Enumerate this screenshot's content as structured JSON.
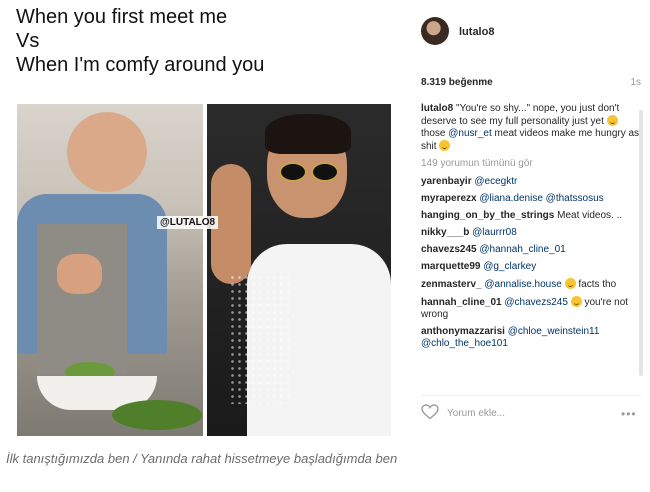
{
  "meme": {
    "line1": "When you first meet me",
    "line2": "Vs",
    "line3": "When I'm comfy around you",
    "watermark": "@LUTALO8"
  },
  "post": {
    "username": "lutalo8",
    "likes": "8.319 beğenme",
    "time": "1s",
    "caption": {
      "user": "lutalo8",
      "text1": "\"You're so shy...\" nope, you just don't deserve to see my full personality just yet",
      "text2": "those",
      "mention": "@nusr_et",
      "text3": "meat videos make me hungry as shit"
    },
    "view_all": "149 yorumun tümünü gör",
    "comments": [
      {
        "user": "yarenbayir",
        "mention": "@ecegktr",
        "text": ""
      },
      {
        "user": "myraperezx",
        "mention": "@liana.denise @thatssosus",
        "text": ""
      },
      {
        "user": "hanging_on_by_the_strings",
        "mention": "",
        "text": "Meat videos. .."
      },
      {
        "user": "nikky___b",
        "mention": "@laurrr08",
        "text": ""
      },
      {
        "user": "chavezs245",
        "mention": "@hannah_cline_01",
        "text": ""
      },
      {
        "user": "marquette99",
        "mention": "@g_clarkey",
        "text": ""
      },
      {
        "user": "zenmasterv_",
        "mention": "@annalise.house",
        "text": "facts tho"
      },
      {
        "user": "hannah_cline_01",
        "mention": "@chavezs245",
        "text": "you're not wrong"
      },
      {
        "user": "anthonymazzarisi",
        "mention": "@chloe_weinstein11 @chlo_the_hoe101",
        "text": ""
      }
    ],
    "comment_placeholder": "Yorum ekle...",
    "more_label": "•••"
  },
  "page_caption": "İlk tanıştığımızda ben / Yanında rahat hissetmeye başladığımda ben",
  "icons": {
    "heart": "heart-icon",
    "more": "more-icon",
    "emoji": "grinning-emoji-icon"
  }
}
